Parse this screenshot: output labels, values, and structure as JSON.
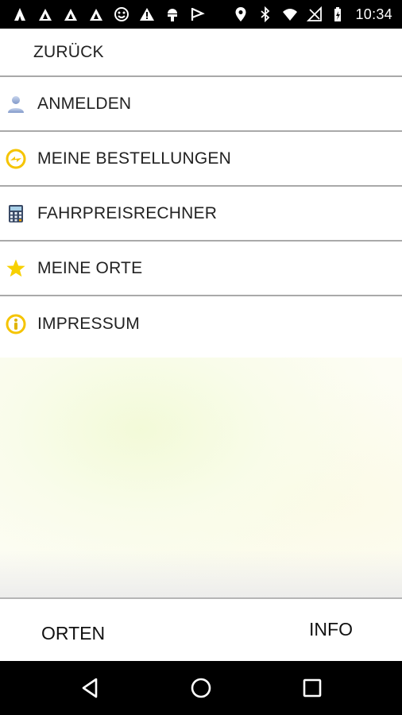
{
  "status_bar": {
    "time": "10:34",
    "left_icons": [
      "tent-icon",
      "tent-icon",
      "tent-icon",
      "face-icon",
      "warning-icon",
      "android-icon",
      "flag-icon"
    ],
    "right_icons": [
      "location-icon",
      "bluetooth-icon",
      "wifi-icon",
      "no-signal-icon",
      "battery-icon"
    ]
  },
  "menu": {
    "back_label": "ZURÜCK",
    "items": [
      {
        "label": "ANMELDEN",
        "icon": "user-icon"
      },
      {
        "label": "MEINE BESTELLUNGEN",
        "icon": "orders-icon"
      },
      {
        "label": "FAHRPREISRECHNER",
        "icon": "calculator-icon"
      },
      {
        "label": "MEINE ORTE",
        "icon": "star-icon"
      },
      {
        "label": "IMPRESSUM",
        "icon": "info-icon"
      }
    ]
  },
  "bottom_bar": {
    "orten_label": "ORTEN",
    "info_label": "INFO"
  },
  "nav_bar": {
    "buttons": [
      "back-icon",
      "home-icon",
      "recents-icon"
    ]
  },
  "colors": {
    "accent_yellow": "#f5c400",
    "divider": "#a9a9a9"
  }
}
